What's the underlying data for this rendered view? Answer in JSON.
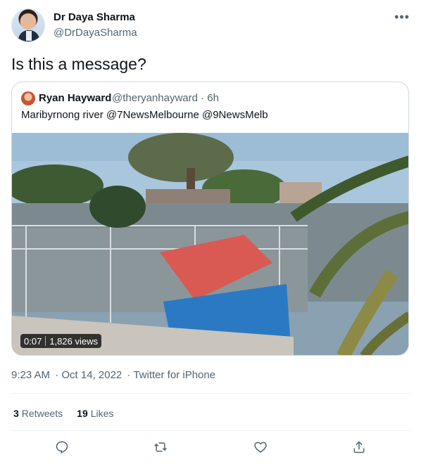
{
  "author": {
    "name": "Dr Daya Sharma",
    "handle": "@DrDayaSharma"
  },
  "more_label": "•••",
  "tweet_text": "Is this a message?",
  "quoted": {
    "name": "Ryan Hayward",
    "handle_time": "@theryanhayward · 6h",
    "text": "Maribyrnong river @7NewsMelbourne @9NewsMelb",
    "video": {
      "duration": "0:07",
      "views": "1,826 views"
    }
  },
  "meta": {
    "time": "9:23 AM",
    "date": "· Oct 14, 2022",
    "source": "· Twitter for iPhone"
  },
  "stats": {
    "retweets_count": "3",
    "retweets_label": "Retweets",
    "likes_count": "19",
    "likes_label": "Likes"
  },
  "colors": {
    "text_secondary": "#536471",
    "border": "#cfd9de"
  }
}
